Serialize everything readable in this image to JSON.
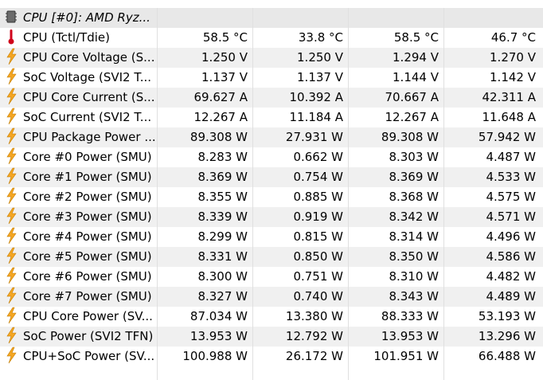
{
  "group": {
    "label": "CPU [#0]: AMD Ryz...",
    "icon": "chip-icon"
  },
  "rows": [
    {
      "icon": "thermometer-icon",
      "label": "CPU (Tctl/Tdie)",
      "values": [
        "58.5 °C",
        "33.8 °C",
        "58.5 °C",
        "46.7 °C"
      ]
    },
    {
      "icon": "lightning-icon",
      "label": "CPU Core Voltage (S...",
      "values": [
        "1.250 V",
        "1.250 V",
        "1.294 V",
        "1.270 V"
      ]
    },
    {
      "icon": "lightning-icon",
      "label": "SoC Voltage (SVI2 T...",
      "values": [
        "1.137 V",
        "1.137 V",
        "1.144 V",
        "1.142 V"
      ]
    },
    {
      "icon": "lightning-icon",
      "label": "CPU Core Current (S...",
      "values": [
        "69.627 A",
        "10.392 A",
        "70.667 A",
        "42.311 A"
      ]
    },
    {
      "icon": "lightning-icon",
      "label": "SoC Current (SVI2 T...",
      "values": [
        "12.267 A",
        "11.184 A",
        "12.267 A",
        "11.648 A"
      ]
    },
    {
      "icon": "lightning-icon",
      "label": "CPU Package Power ...",
      "values": [
        "89.308 W",
        "27.931 W",
        "89.308 W",
        "57.942 W"
      ]
    },
    {
      "icon": "lightning-icon",
      "label": "Core #0 Power (SMU)",
      "values": [
        "8.283 W",
        "0.662 W",
        "8.303 W",
        "4.487 W"
      ]
    },
    {
      "icon": "lightning-icon",
      "label": "Core #1 Power (SMU)",
      "values": [
        "8.369 W",
        "0.754 W",
        "8.369 W",
        "4.533 W"
      ]
    },
    {
      "icon": "lightning-icon",
      "label": "Core #2 Power (SMU)",
      "values": [
        "8.355 W",
        "0.885 W",
        "8.368 W",
        "4.575 W"
      ]
    },
    {
      "icon": "lightning-icon",
      "label": "Core #3 Power (SMU)",
      "values": [
        "8.339 W",
        "0.919 W",
        "8.342 W",
        "4.571 W"
      ]
    },
    {
      "icon": "lightning-icon",
      "label": "Core #4 Power (SMU)",
      "values": [
        "8.299 W",
        "0.815 W",
        "8.314 W",
        "4.496 W"
      ]
    },
    {
      "icon": "lightning-icon",
      "label": "Core #5 Power (SMU)",
      "values": [
        "8.331 W",
        "0.850 W",
        "8.350 W",
        "4.586 W"
      ]
    },
    {
      "icon": "lightning-icon",
      "label": "Core #6 Power (SMU)",
      "values": [
        "8.300 W",
        "0.751 W",
        "8.310 W",
        "4.482 W"
      ]
    },
    {
      "icon": "lightning-icon",
      "label": "Core #7 Power (SMU)",
      "values": [
        "8.327 W",
        "0.740 W",
        "8.343 W",
        "4.489 W"
      ]
    },
    {
      "icon": "lightning-icon",
      "label": "CPU Core Power (SV...",
      "values": [
        "87.034 W",
        "13.380 W",
        "88.333 W",
        "53.193 W"
      ]
    },
    {
      "icon": "lightning-icon",
      "label": "SoC Power (SVI2 TFN)",
      "values": [
        "13.953 W",
        "12.792 W",
        "13.953 W",
        "13.296 W"
      ]
    },
    {
      "icon": "lightning-icon",
      "label": "CPU+SoC Power (SV...",
      "values": [
        "100.988 W",
        "26.172 W",
        "101.951 W",
        "66.488 W"
      ]
    }
  ],
  "colors": {
    "lightning": "#f5a623",
    "thermometer": "#d0021b",
    "group_bg": "#e8e8e8",
    "alt_row": "#f0f0f0"
  }
}
